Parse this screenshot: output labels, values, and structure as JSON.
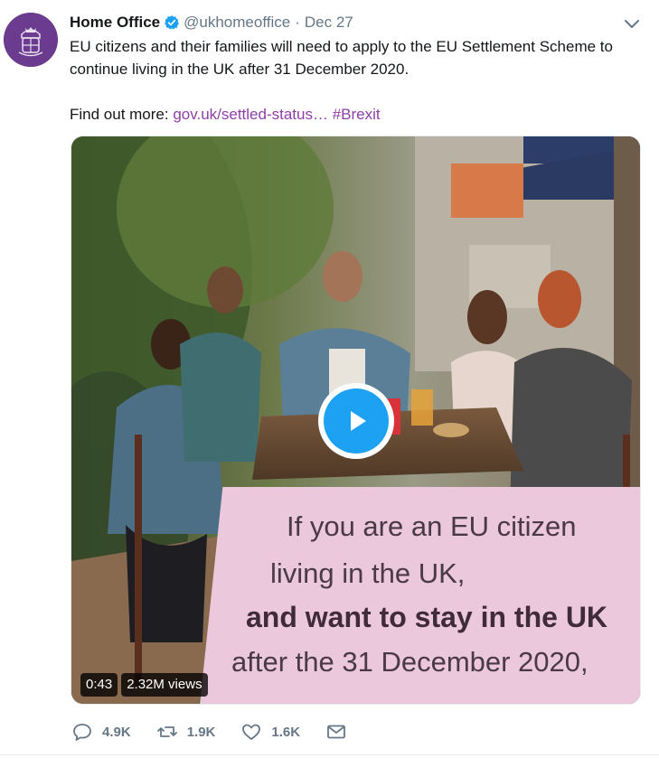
{
  "tweet": {
    "name": "Home Office",
    "handle": "@ukhomeoffice",
    "separator": "·",
    "date": "Dec 27",
    "text_line1": "EU citizens and their families will need to apply to the EU Settlement Scheme to",
    "text_line2": "continue living in the UK after 31 December 2020.",
    "find_more": "Find out more: ",
    "link": "gov.uk/settled-status…",
    "hashtag": "#Brexit"
  },
  "video": {
    "overlay_line1": "If you are an EU citizen",
    "overlay_line2": "living in the UK,",
    "overlay_line3": "and want to stay in the UK",
    "overlay_line4": "after the 31 December 2020,",
    "duration": "0:43",
    "views": "2.32M views"
  },
  "actions": {
    "replies": "4.9K",
    "retweets": "1.9K",
    "likes": "1.6K"
  },
  "icons": {
    "reply": "reply-icon",
    "retweet": "retweet-icon",
    "like": "heart-icon",
    "dm": "envelope-icon",
    "play": "play-icon",
    "verified": "verified-badge-icon",
    "caret": "chevron-down-icon"
  },
  "colors": {
    "accent": "#1da1f2",
    "link": "#8e3fa8",
    "muted": "#657786",
    "avatar_bg": "#6b3b8f",
    "overlay_card": "#ecc8dc"
  }
}
